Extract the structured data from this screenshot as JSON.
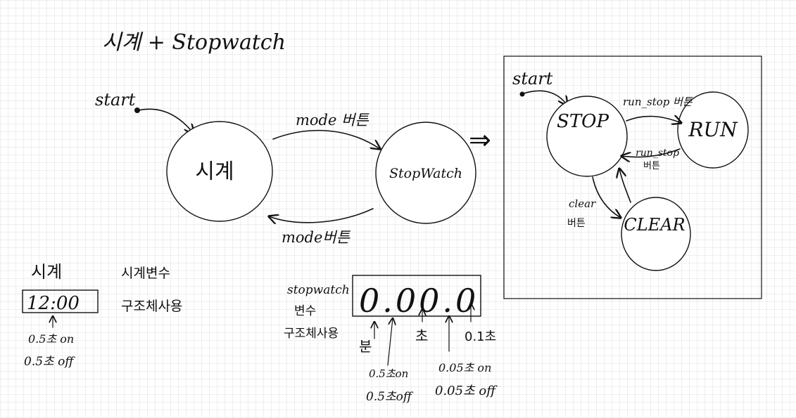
{
  "title": "시계 + Stopwatch",
  "main_fsm": {
    "start_label": "start",
    "clock_node": "시계",
    "stopwatch_node": "StopWatch",
    "to_stopwatch_label": "mode 버튼",
    "to_clock_label": "mode버튼",
    "expand_arrow": "⇒"
  },
  "stopwatch_fsm": {
    "start_label": "start",
    "stop_node": "STOP",
    "run_node": "RUN",
    "clear_node": "CLEAR",
    "run_stop_top_label": "run_stop 버튼",
    "run_stop_bottom_label": "run_stop",
    "run_stop_bottom_label2": "버튼",
    "clear_label": "clear",
    "clear_label2": "버튼"
  },
  "clock_display": {
    "title": "시계",
    "value": "12:00",
    "note_line1": "시계변수",
    "note_line2": "구조체사용",
    "blink_on": "0.5초 on",
    "blink_off": "0.5초 off"
  },
  "stopwatch_display": {
    "label_line1": "stopwatch",
    "label_line2": "변수",
    "label_line3": "구조체사용",
    "value": "0.00.0",
    "unit_min": "분",
    "unit_sec": "초",
    "unit_tenth": "0.1초",
    "min_blink_on": "0.5초on",
    "min_blink_off": "0.5초off",
    "dot_blink_on": "0.05초 on",
    "dot_blink_off": "0.05초 off"
  }
}
